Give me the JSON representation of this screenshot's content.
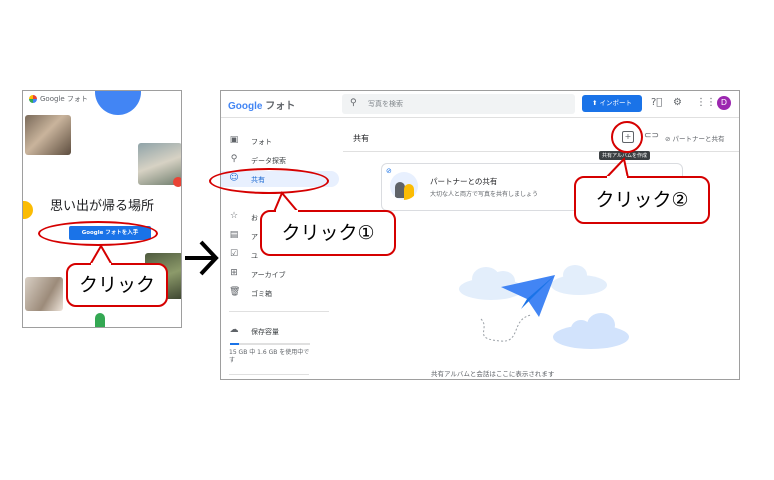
{
  "left_panel": {
    "logo_text": "Google フォト",
    "headline": "思い出が帰る場所",
    "cta_label": "Google フォトを入手"
  },
  "main": {
    "logo_g": "Google",
    "logo_rest": " フォト",
    "search_placeholder": "写真を検索",
    "import_label": "⬆ インポート",
    "avatar_letter": "D",
    "sidebar": [
      {
        "label": "フォト",
        "icon": "photo-icon"
      },
      {
        "label": "データ探索",
        "icon": "search-icon"
      },
      {
        "label": "共有",
        "icon": "people-icon"
      },
      {
        "label": "お",
        "icon": "star-icon"
      },
      {
        "label": "ア",
        "icon": "album-icon"
      },
      {
        "label": "ユ",
        "icon": "utility-icon"
      },
      {
        "label": "アーカイブ",
        "icon": "archive-icon"
      },
      {
        "label": "ゴミ箱",
        "icon": "trash-icon"
      }
    ],
    "storage_label": "保存容量",
    "storage_detail": "15 GB 中 1.6 GB を使用中です",
    "storage_fraction": 0.11,
    "page_title": "共有",
    "partner_share_label": "パートナーと共有",
    "tooltip": "共有アルバムを作成",
    "card_title": "パートナーとの共有",
    "card_subtitle": "大切な人と両方で写真を共有しましょう",
    "empty_text": "共有アルバムと会話はここに表示されます"
  },
  "callouts": {
    "left_click": "クリック",
    "click_one": "クリック①",
    "click_two": "クリック②"
  },
  "colors": {
    "accent": "#1a73e8",
    "callout_red": "#d50000",
    "avatar": "#9c27b0"
  }
}
